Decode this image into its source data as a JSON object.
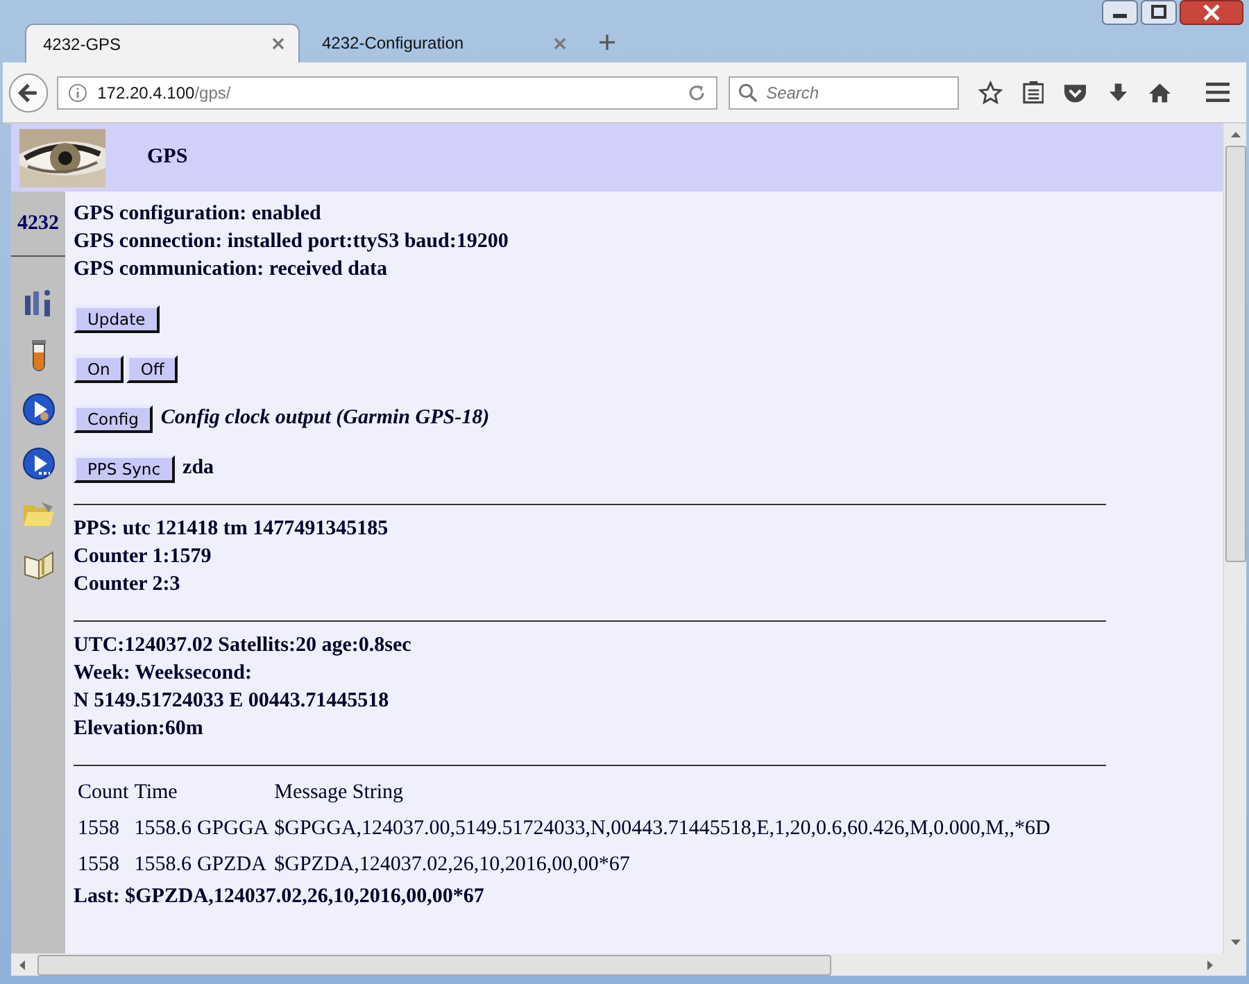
{
  "tabs": [
    {
      "label": "4232-GPS",
      "selected": true
    },
    {
      "label": "4232-Configuration",
      "selected": false
    }
  ],
  "address": {
    "host": "172.20.4.100",
    "path": "/gps/"
  },
  "search": {
    "placeholder": "Search"
  },
  "page": {
    "title": "GPS",
    "sidebar_label": "4232",
    "status_lines": [
      "GPS configuration: enabled",
      "GPS connection: installed port:ttyS3 baud:19200",
      "GPS communication: received data"
    ],
    "actions": [
      {
        "buttons": [
          "Update"
        ]
      },
      {
        "buttons": [
          "On",
          "Off"
        ]
      },
      {
        "buttons": [
          "Config"
        ],
        "note": "Config clock output (Garmin GPS-18)",
        "kind": "italic"
      },
      {
        "buttons": [
          "PPS Sync"
        ],
        "note": "zda",
        "kind": "plain"
      }
    ],
    "sections": [
      [
        "PPS: utc 121418 tm 1477491345185",
        "Counter 1:1579",
        "Counter 2:3"
      ],
      [
        "UTC:124037.02 Satellits:20 age:0.8sec",
        "Week: Weeksecond:",
        "N 5149.51724033 E 00443.71445518",
        "Elevation:60m"
      ]
    ],
    "table": {
      "columns": [
        "Count",
        "Time",
        "",
        "Message String"
      ],
      "rows": [
        [
          "1558",
          "1558.6",
          "GPGGA",
          "$GPGGA,124037.00,5149.51724033,N,00443.71445518,E,1,20,0.6,60.426,M,0.000,M,,*6D"
        ],
        [
          "1558",
          "1558.6",
          "GPZDA",
          "$GPZDA,124037.02,26,10,2016,00,00*67"
        ]
      ]
    },
    "last": "Last: $GPZDA,124037.02,26,10,2016,00,00*67"
  }
}
